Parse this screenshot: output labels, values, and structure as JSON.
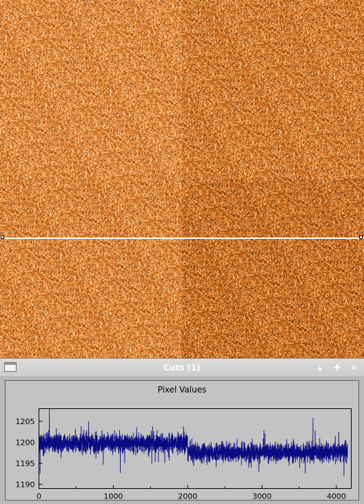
{
  "window": {
    "title": "Cuts (1)",
    "controls": {
      "shade_glyph": "▴",
      "pin_glyph": "✚",
      "close_glyph": "✕"
    }
  },
  "viewer": {
    "colormap_colors": [
      "#000000",
      "#3b1400",
      "#8a3a06",
      "#d4701c",
      "#f4a04c",
      "#ffd9a8",
      "#ffffff"
    ],
    "cut_line_color": "#ffffff"
  },
  "chart_data": {
    "type": "line",
    "title": "Pixel Values",
    "xlabel": "",
    "ylabel": "",
    "xlim": [
      0,
      4200
    ],
    "ylim": [
      1189,
      1208
    ],
    "x_ticks": [
      0,
      1000,
      2000,
      3000,
      4000
    ],
    "y_ticks": [
      1190,
      1195,
      1200,
      1205
    ],
    "line_color": "#0a0a82",
    "grid": false,
    "series": [
      {
        "x_range": [
          0,
          4150
        ],
        "y_mean_segments": [
          {
            "x_from": 0,
            "x_to": 2000,
            "mean": 1199.8
          },
          {
            "x_from": 2000,
            "x_to": 4150,
            "mean": 1197.6
          }
        ],
        "y_min": 1190,
        "y_max": 1208,
        "note_values": "dense noisy pixel cut centered near 1198"
      }
    ]
  }
}
